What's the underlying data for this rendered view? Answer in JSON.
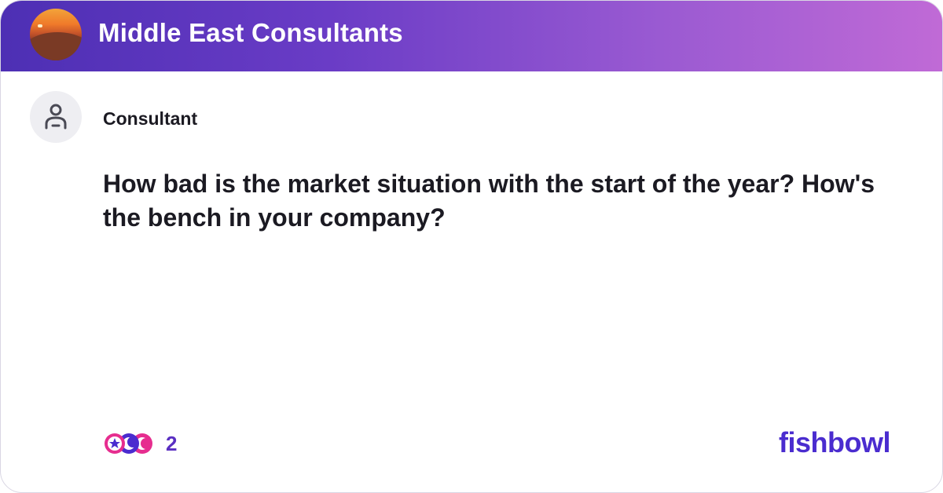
{
  "header": {
    "group_name": "Middle East Consultants",
    "group_avatar_icon": "desert-sunset-avatar",
    "gradient_colors": [
      "#4d2fb4",
      "#c06ad6"
    ]
  },
  "post": {
    "author_label": "Consultant",
    "author_avatar_icon": "user-icon",
    "text": "How bad is the market situation with the start of the year? How's the bench in your company?"
  },
  "footer": {
    "reaction_icons": [
      "star-reaction-icon",
      "moon-reaction-icon",
      "wink-reaction-icon"
    ],
    "reaction_count": "2",
    "brand": "fishbowl",
    "brand_color": "#4a2ccf"
  }
}
